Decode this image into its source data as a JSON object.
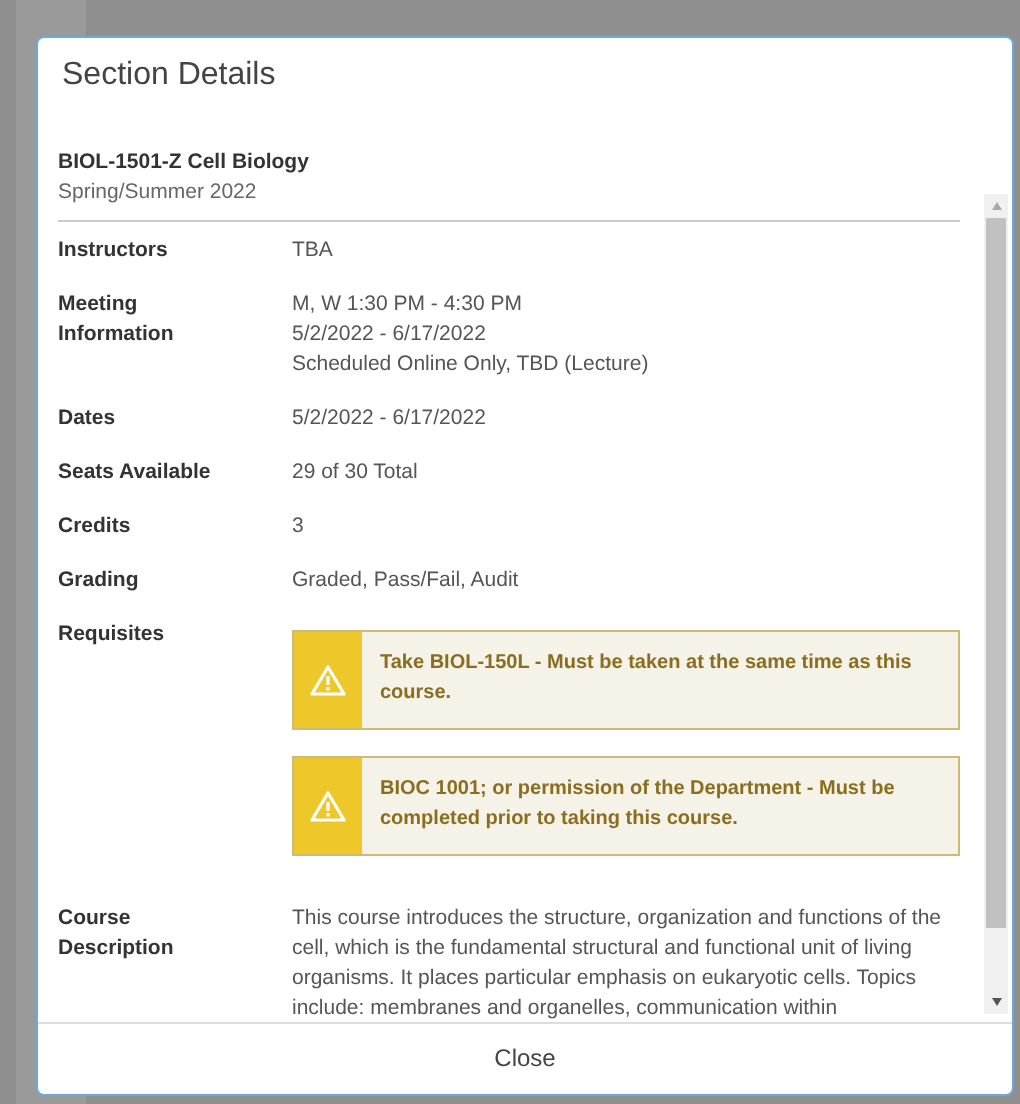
{
  "dialog": {
    "title": "Section Details",
    "course_title": "BIOL-1501-Z Cell Biology",
    "term": "Spring/Summer 2022",
    "rows": [
      {
        "kind": "text",
        "label": "Instructors",
        "lines": [
          "TBA"
        ]
      },
      {
        "kind": "text",
        "label": "Meeting Information",
        "lines": [
          "M, W 1:30 PM - 4:30 PM",
          "5/2/2022 - 6/17/2022",
          "Scheduled Online Only, TBD (Lecture)"
        ]
      },
      {
        "kind": "text",
        "label": "Dates",
        "lines": [
          "5/2/2022 - 6/17/2022"
        ]
      },
      {
        "kind": "text",
        "label": "Seats Available",
        "lines": [
          "29 of 30 Total"
        ]
      },
      {
        "kind": "text",
        "label": "Credits",
        "lines": [
          "3"
        ]
      },
      {
        "kind": "text",
        "label": "Grading",
        "lines": [
          "Graded, Pass/Fail, Audit"
        ]
      },
      {
        "kind": "alerts",
        "label": "Requisites",
        "alerts": [
          "Take BIOL-150L - Must be taken at the same time as this course.",
          "BIOC 1001; or permission of the Department - Must be completed prior to taking this course."
        ]
      },
      {
        "kind": "paragraph",
        "label": "Course Description",
        "text": "This course introduces the structure, organization and functions of the cell, which is the fundamental structural and functional unit of living organisms. It places particular emphasis on eukaryotic cells. Topics include: membranes and organelles, communication within"
      }
    ],
    "close_button": "Close"
  }
}
